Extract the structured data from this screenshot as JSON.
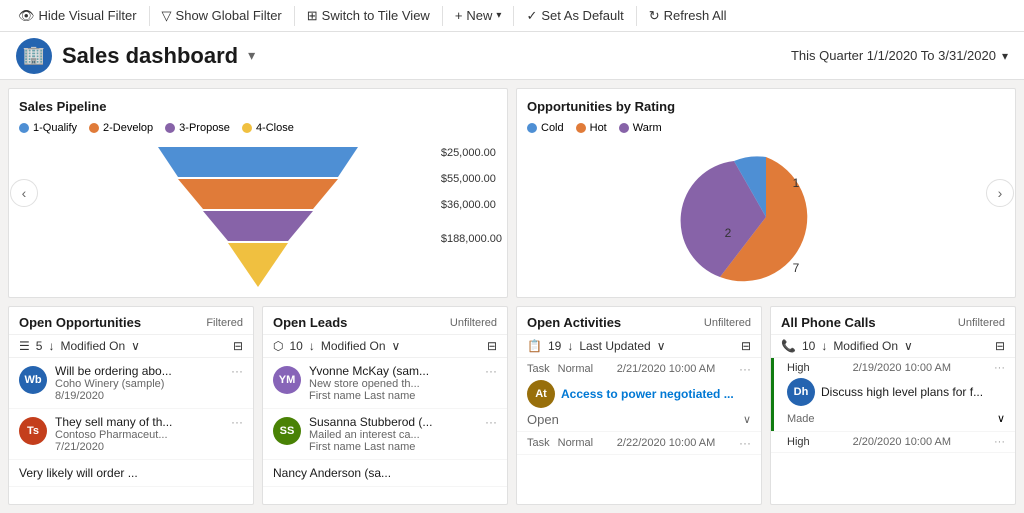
{
  "toolbar": {
    "hide_visual_filter": "Hide Visual Filter",
    "show_global_filter": "Show Global Filter",
    "switch_to_tile_view": "Switch to Tile View",
    "new": "New",
    "set_as_default": "Set As Default",
    "refresh_all": "Refresh All"
  },
  "header": {
    "title": "Sales dashboard",
    "date_range": "This Quarter 1/1/2020 To 3/31/2020",
    "icon": "🏢"
  },
  "sales_pipeline": {
    "title": "Sales Pipeline",
    "legend": [
      {
        "label": "1-Qualify",
        "color": "#4e8fd4"
      },
      {
        "label": "2-Develop",
        "color": "#e07b39"
      },
      {
        "label": "3-Propose",
        "color": "#8763a8"
      },
      {
        "label": "4-Close",
        "color": "#f0c040"
      }
    ],
    "values": [
      {
        "amount": "$25,000.00",
        "color": "#4e8fd4"
      },
      {
        "amount": "$55,000.00",
        "color": "#e07b39"
      },
      {
        "amount": "$36,000.00",
        "color": "#8763a8"
      },
      {
        "amount": "$188,000.00",
        "color": "#f0c040"
      }
    ]
  },
  "opportunities_by_rating": {
    "title": "Opportunities by Rating",
    "legend": [
      {
        "label": "Cold",
        "color": "#4e8fd4"
      },
      {
        "label": "Hot",
        "color": "#e07b39"
      },
      {
        "label": "Warm",
        "color": "#8763a8"
      }
    ],
    "segments": [
      {
        "label": "1",
        "value": 1
      },
      {
        "label": "2",
        "value": 2
      },
      {
        "label": "7",
        "value": 7
      }
    ]
  },
  "open_opportunities": {
    "title": "Open Opportunities",
    "badge": "Filtered",
    "count": "5",
    "sort": "Modified On",
    "items": [
      {
        "initials": "Wb",
        "color": "#2564b0",
        "line1": "Will be ordering abo...",
        "line2": "Coho Winery (sample)",
        "line3": "8/19/2020"
      },
      {
        "initials": "Ts",
        "color": "#c43e1c",
        "line1": "They sell many of th...",
        "line2": "Contoso Pharmaceut...",
        "line3": "7/21/2020"
      },
      {
        "initials": "",
        "color": "#aaa",
        "line1": "Very likely will order ...",
        "line2": "",
        "line3": ""
      }
    ]
  },
  "open_leads": {
    "title": "Open Leads",
    "badge": "Unfiltered",
    "count": "10",
    "sort": "Modified On",
    "items": [
      {
        "initials": "YM",
        "color": "#8764b8",
        "line1": "Yvonne McKay (sam...",
        "line2": "New store opened th...",
        "line3": "First name Last name"
      },
      {
        "initials": "SS",
        "color": "#498205",
        "line1": "Susanna Stubberod (...",
        "line2": "Mailed an interest ca...",
        "line3": "First name Last name"
      },
      {
        "initials": "",
        "color": "#aaa",
        "line1": "Nancy Anderson (sa...",
        "line2": "",
        "line3": ""
      }
    ]
  },
  "open_activities": {
    "title": "Open Activities",
    "badge": "Unfiltered",
    "count": "19",
    "sort": "Last Updated",
    "items": [
      {
        "tag1": "Task",
        "tag2": "Normal",
        "date": "2/21/2020 10:00 AM",
        "initials": "At",
        "color": "#986f0b",
        "text": "Access to power negotiated ...",
        "status": "Open"
      },
      {
        "tag1": "Task",
        "tag2": "Normal",
        "date": "2/22/2020 10:00 AM",
        "initials": "",
        "color": "#aaa",
        "text": "",
        "status": ""
      }
    ]
  },
  "all_phone_calls": {
    "title": "All Phone Calls",
    "badge": "Unfiltered",
    "count": "10",
    "sort": "Modified On",
    "items": [
      {
        "priority": "High",
        "time": "2/19/2020 10:00 AM",
        "initials": "Dh",
        "color": "#2564b0",
        "text": "Discuss high level plans for f...",
        "status": "Made"
      },
      {
        "priority": "High",
        "time": "2/20/2020 10:00 AM",
        "initials": "",
        "color": "#aaa",
        "text": "",
        "status": ""
      }
    ]
  }
}
